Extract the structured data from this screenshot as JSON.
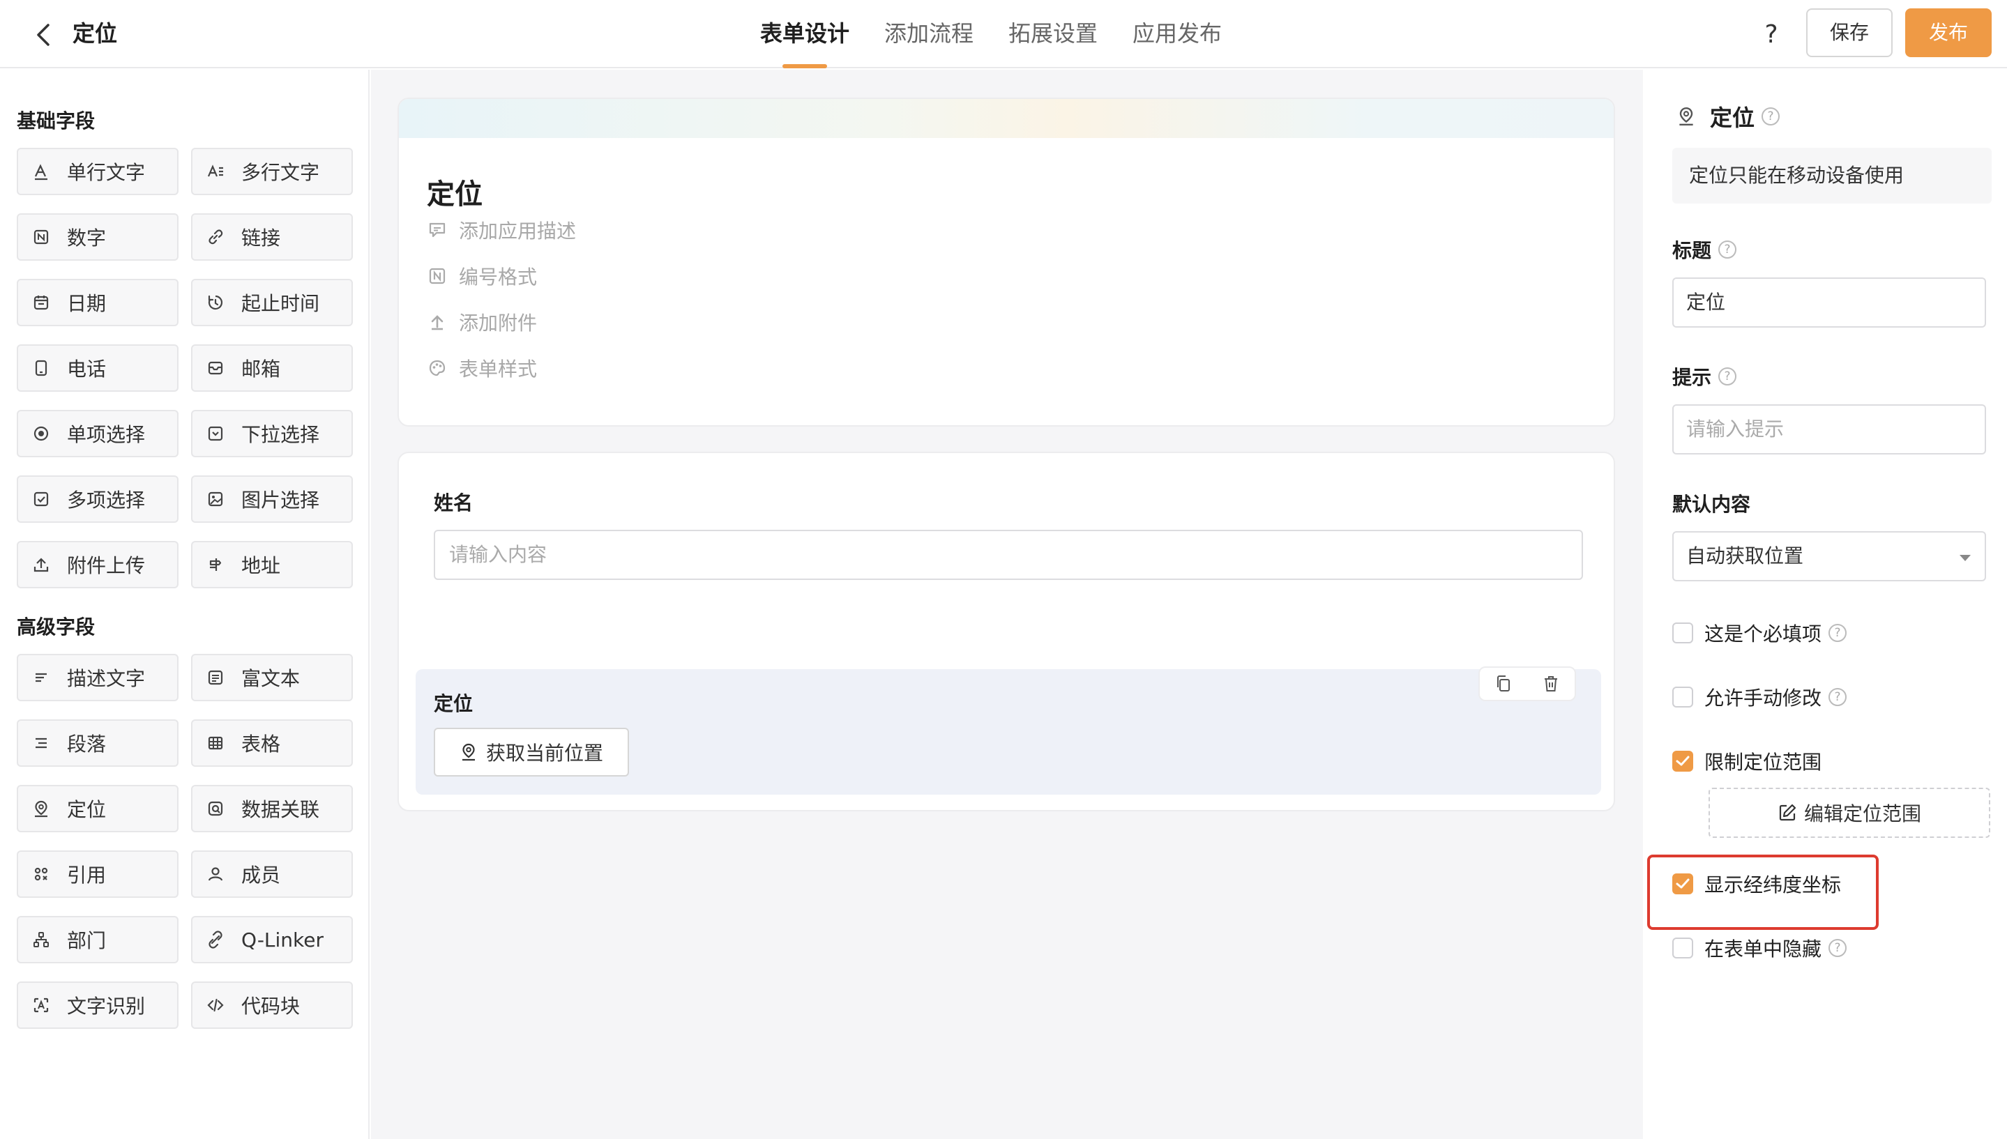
{
  "header": {
    "title": "定位",
    "tabs": [
      {
        "label": "表单设计",
        "active": true
      },
      {
        "label": "添加流程",
        "active": false
      },
      {
        "label": "拓展设置",
        "active": false
      },
      {
        "label": "应用发布",
        "active": false
      }
    ],
    "help": "?",
    "save_label": "保存",
    "publish_label": "发布"
  },
  "sidebar": {
    "basic_title": "基础字段",
    "basic_fields": [
      {
        "label": "单行文字",
        "icon": "single-line-text-icon"
      },
      {
        "label": "多行文字",
        "icon": "multi-line-text-icon"
      },
      {
        "label": "数字",
        "icon": "number-icon"
      },
      {
        "label": "链接",
        "icon": "link-icon"
      },
      {
        "label": "日期",
        "icon": "calendar-icon"
      },
      {
        "label": "起止时间",
        "icon": "time-range-icon"
      },
      {
        "label": "电话",
        "icon": "phone-icon"
      },
      {
        "label": "邮箱",
        "icon": "mail-icon"
      },
      {
        "label": "单项选择",
        "icon": "radio-icon"
      },
      {
        "label": "下拉选择",
        "icon": "dropdown-icon"
      },
      {
        "label": "多项选择",
        "icon": "checkbox-icon"
      },
      {
        "label": "图片选择",
        "icon": "image-icon"
      },
      {
        "label": "附件上传",
        "icon": "upload-icon"
      },
      {
        "label": "地址",
        "icon": "address-icon"
      }
    ],
    "advanced_title": "高级字段",
    "advanced_fields": [
      {
        "label": "描述文字",
        "icon": "description-icon"
      },
      {
        "label": "富文本",
        "icon": "rich-text-icon"
      },
      {
        "label": "段落",
        "icon": "paragraph-icon"
      },
      {
        "label": "表格",
        "icon": "table-icon"
      },
      {
        "label": "定位",
        "icon": "location-icon"
      },
      {
        "label": "数据关联",
        "icon": "data-link-icon"
      },
      {
        "label": "引用",
        "icon": "reference-icon"
      },
      {
        "label": "成员",
        "icon": "member-icon"
      },
      {
        "label": "部门",
        "icon": "department-icon"
      },
      {
        "label": "Q-Linker",
        "icon": "q-linker-icon"
      },
      {
        "label": "文字识别",
        "icon": "ocr-icon"
      },
      {
        "label": "代码块",
        "icon": "code-icon"
      }
    ]
  },
  "canvas": {
    "form_title": "定位",
    "meta": [
      {
        "label": "添加应用描述",
        "icon": "comment-icon"
      },
      {
        "label": "编号格式",
        "icon": "number-format-icon"
      },
      {
        "label": "添加附件",
        "icon": "attachment-upload-icon"
      },
      {
        "label": "表单样式",
        "icon": "palette-icon"
      }
    ],
    "name_field": {
      "label": "姓名",
      "placeholder": "请输入内容"
    },
    "location_field": {
      "label": "定位",
      "button_label": "获取当前位置"
    }
  },
  "panel": {
    "field_name": "定位",
    "note": "定位只能在移动设备使用",
    "title_label": "标题",
    "title_value": "定位",
    "hint_label": "提示",
    "hint_placeholder": "请输入提示",
    "default_label": "默认内容",
    "default_value": "自动获取位置",
    "options": [
      {
        "label": "这是个必填项",
        "checked": false,
        "help": true
      },
      {
        "label": "允许手动修改",
        "checked": false,
        "help": true
      },
      {
        "label": "限制定位范围",
        "checked": true,
        "help": false
      },
      {
        "label": "显示经纬度坐标",
        "checked": true,
        "help": false
      },
      {
        "label": "在表单中隐藏",
        "checked": false,
        "help": true
      }
    ],
    "edit_range_label": "编辑定位范围"
  },
  "colors": {
    "accent": "#ef9a45",
    "highlight": "#dd3b2f"
  }
}
